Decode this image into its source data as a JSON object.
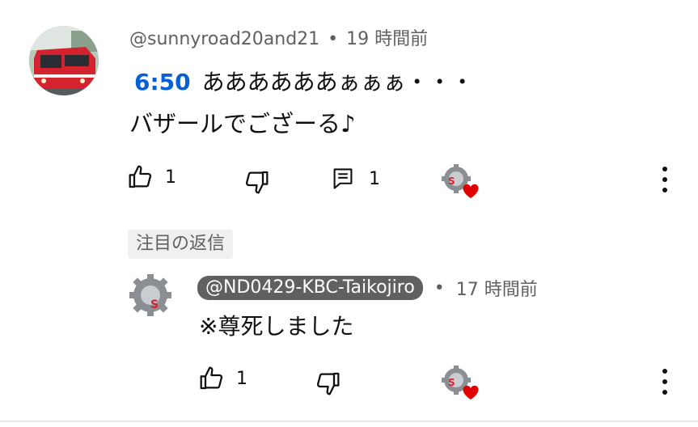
{
  "comment": {
    "author": "@sunnyroad20and21",
    "separator": "•",
    "time": "19 時間前",
    "timestamp_link": "6:50",
    "line1_text": "ああああああぁぁぁ・・・",
    "line2_text": "バザールでござーる♪",
    "like_count": "1",
    "reply_count": "1"
  },
  "pinned_label": "注目の返信",
  "reply": {
    "author": "@ND0429-KBC-Taikojiro",
    "separator": "•",
    "time": "17 時間前",
    "text": "※尊死しました",
    "like_count": "1"
  },
  "colors": {
    "timestamp_link": "#065fd4",
    "meta_text": "#606060",
    "heart": "#e00000",
    "train_red": "#d4232f"
  },
  "icons": {
    "like": "thumbs-up-icon",
    "dislike": "thumbs-down-icon",
    "reply": "comment-icon",
    "creator_heart": "creator-heart-icon",
    "more": "more-vertical-icon"
  }
}
